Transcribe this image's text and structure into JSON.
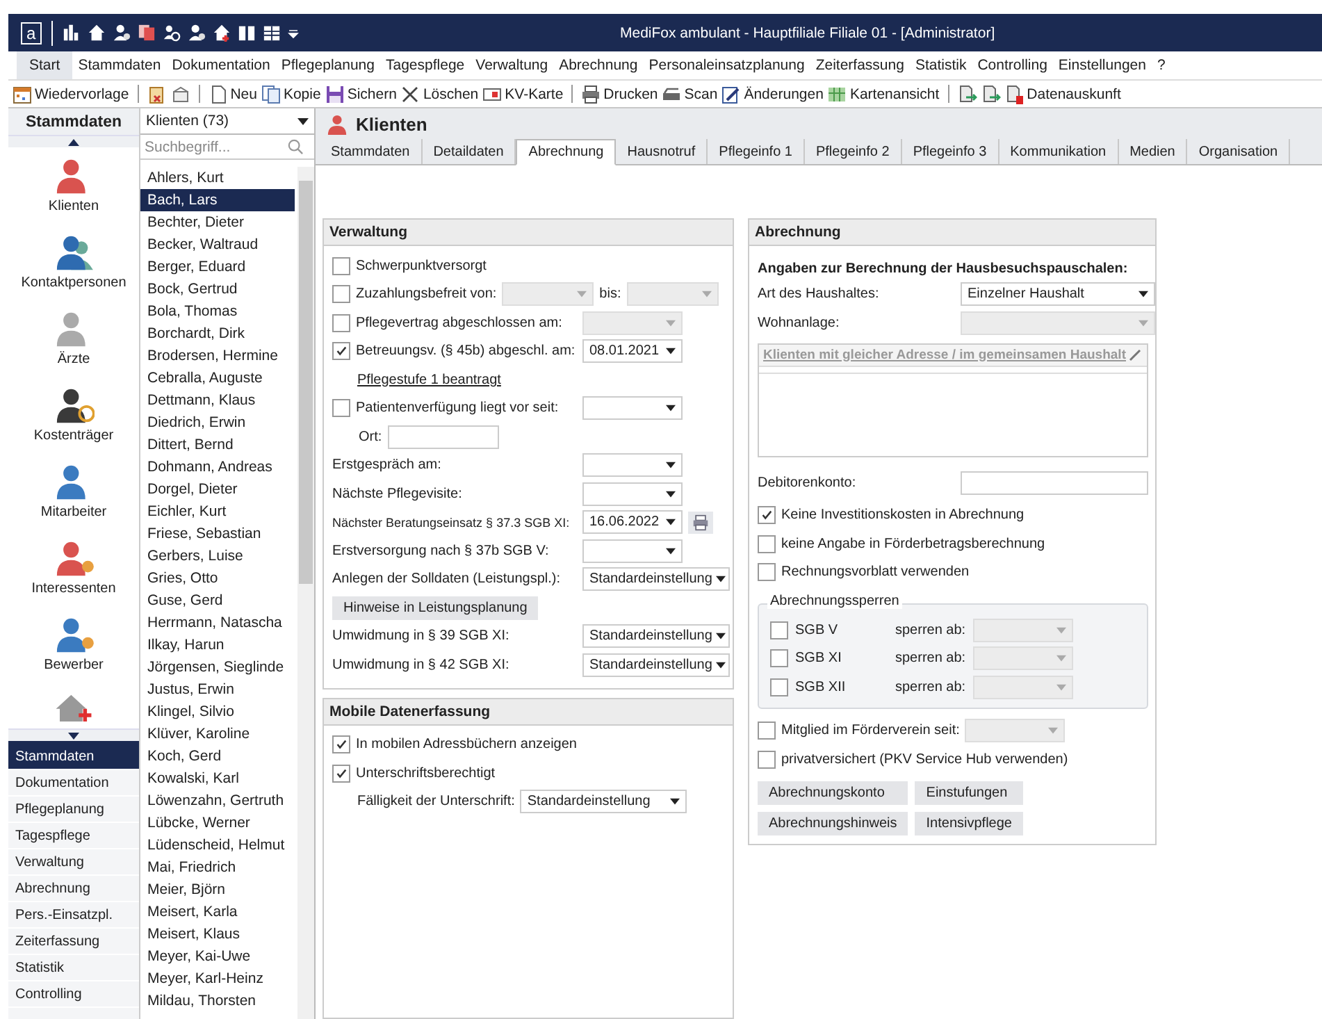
{
  "window": {
    "logo": "a",
    "title": "MediFox ambulant  -  Hauptfiliale Filiale 01 - [Administrator]"
  },
  "menu": {
    "items": [
      {
        "label": "Start",
        "selected": true
      },
      {
        "label": "Stammdaten",
        "selected": false
      },
      {
        "label": "Dokumentation",
        "selected": false
      },
      {
        "label": "Pflegeplanung",
        "selected": false
      },
      {
        "label": "Tagespflege",
        "selected": false
      },
      {
        "label": "Verwaltung",
        "selected": false
      },
      {
        "label": "Abrechnung",
        "selected": false
      },
      {
        "label": "Personaleinsatzplanung",
        "selected": false
      },
      {
        "label": "Zeiterfassung",
        "selected": false
      },
      {
        "label": "Statistik",
        "selected": false
      },
      {
        "label": "Controlling",
        "selected": false
      },
      {
        "label": "Einstellungen",
        "selected": false
      },
      {
        "label": "?",
        "selected": false
      }
    ]
  },
  "toolbar": {
    "groups": [
      [
        {
          "kind": "labeled",
          "label": "Wiedervorlage"
        }
      ],
      [
        {
          "kind": "icon"
        },
        {
          "kind": "icon"
        }
      ],
      [
        {
          "kind": "labeled",
          "label": "Neu"
        },
        {
          "kind": "labeled",
          "label": "Kopie"
        },
        {
          "kind": "labeled",
          "label": "Sichern"
        },
        {
          "kind": "labeled",
          "label": "Löschen"
        },
        {
          "kind": "labeled",
          "label": "KV-Karte"
        }
      ],
      [
        {
          "kind": "labeled",
          "label": "Drucken"
        },
        {
          "kind": "labeled",
          "label": "Scan"
        },
        {
          "kind": "labeled",
          "label": "Änderungen"
        },
        {
          "kind": "labeled",
          "label": "Kartenansicht"
        }
      ],
      [
        {
          "kind": "icon"
        },
        {
          "kind": "icon"
        },
        {
          "kind": "labeled",
          "label": "Datenauskunft"
        }
      ]
    ]
  },
  "sidebar": {
    "title": "Stammdaten",
    "items": [
      {
        "label": "Klienten"
      },
      {
        "label": "Kontaktpersonen"
      },
      {
        "label": "Ärzte"
      },
      {
        "label": "Kostenträger"
      },
      {
        "label": "Mitarbeiter"
      },
      {
        "label": "Interessenten"
      },
      {
        "label": "Bewerber"
      }
    ],
    "modules": [
      {
        "label": "Stammdaten",
        "selected": true
      },
      {
        "label": "Dokumentation",
        "selected": false
      },
      {
        "label": "Pflegeplanung",
        "selected": false
      },
      {
        "label": "Tagespflege",
        "selected": false
      },
      {
        "label": "Verwaltung",
        "selected": false
      },
      {
        "label": "Abrechnung",
        "selected": false
      },
      {
        "label": "Pers.-Einsatzpl.",
        "selected": false
      },
      {
        "label": "Zeiterfassung",
        "selected": false
      },
      {
        "label": "Statistik",
        "selected": false
      },
      {
        "label": "Controlling",
        "selected": false
      }
    ]
  },
  "client_list": {
    "filter": "Klienten (73)",
    "search": {
      "placeholder": "Suchbegriff..."
    },
    "items": [
      {
        "name": "Ahlers, Kurt",
        "selected": false
      },
      {
        "name": "Bach, Lars",
        "selected": true
      },
      {
        "name": "Bechter, Dieter",
        "selected": false
      },
      {
        "name": "Becker, Waltraud",
        "selected": false
      },
      {
        "name": "Berger, Eduard",
        "selected": false
      },
      {
        "name": "Bock, Gertrud",
        "selected": false
      },
      {
        "name": "Bola, Thomas",
        "selected": false
      },
      {
        "name": "Borchardt, Dirk",
        "selected": false
      },
      {
        "name": "Brodersen, Hermine",
        "selected": false
      },
      {
        "name": "Cebralla, Auguste",
        "selected": false
      },
      {
        "name": "Dettmann, Klaus",
        "selected": false
      },
      {
        "name": "Diedrich, Erwin",
        "selected": false
      },
      {
        "name": "Dittert, Bernd",
        "selected": false
      },
      {
        "name": "Dohmann, Andreas",
        "selected": false
      },
      {
        "name": "Dorgel, Dieter",
        "selected": false
      },
      {
        "name": "Eichler, Kurt",
        "selected": false
      },
      {
        "name": "Friese, Sebastian",
        "selected": false
      },
      {
        "name": "Gerbers, Luise",
        "selected": false
      },
      {
        "name": "Gries, Otto",
        "selected": false
      },
      {
        "name": "Guse, Gerd",
        "selected": false
      },
      {
        "name": "Herrmann, Natascha",
        "selected": false
      },
      {
        "name": "Ilkay, Harun",
        "selected": false
      },
      {
        "name": "Jörgensen, Sieglinde",
        "selected": false
      },
      {
        "name": "Justus, Erwin",
        "selected": false
      },
      {
        "name": "Klingel, Silvio",
        "selected": false
      },
      {
        "name": "Klüver, Karoline",
        "selected": false
      },
      {
        "name": "Koch, Gerd",
        "selected": false
      },
      {
        "name": "Kowalski, Karl",
        "selected": false
      },
      {
        "name": "Löwenzahn, Gertruth",
        "selected": false
      },
      {
        "name": "Lübcke, Werner",
        "selected": false
      },
      {
        "name": "Lüdenscheid, Helmut",
        "selected": false
      },
      {
        "name": "Mai, Friedrich",
        "selected": false
      },
      {
        "name": "Meier, Björn",
        "selected": false
      },
      {
        "name": "Meisert, Karla",
        "selected": false
      },
      {
        "name": "Meisert, Klaus",
        "selected": false
      },
      {
        "name": "Meyer, Kai-Uwe",
        "selected": false
      },
      {
        "name": "Meyer, Karl-Heinz",
        "selected": false
      },
      {
        "name": "Mildau, Thorsten",
        "selected": false
      }
    ]
  },
  "page": {
    "title": "Klienten",
    "tabs": [
      {
        "label": "Stammdaten",
        "selected": false
      },
      {
        "label": "Detaildaten",
        "selected": false
      },
      {
        "label": "Abrechnung",
        "selected": true
      },
      {
        "label": "Hausnotruf",
        "selected": false
      },
      {
        "label": "Pflegeinfo 1",
        "selected": false
      },
      {
        "label": "Pflegeinfo 2",
        "selected": false
      },
      {
        "label": "Pflegeinfo 3",
        "selected": false
      },
      {
        "label": "Kommunikation",
        "selected": false
      },
      {
        "label": "Medien",
        "selected": false
      },
      {
        "label": "Organisation",
        "selected": false
      }
    ]
  },
  "verwaltung": {
    "title": "Verwaltung",
    "rows": [
      {
        "kind": "check",
        "label": "Schwerpunktversorgt",
        "checked": false
      },
      {
        "kind": "check_range",
        "label": "Zuzahlungsbefreit von:",
        "checked": false,
        "to_label": "bis:",
        "from": {
          "disabled": true
        },
        "to": {
          "disabled": true
        }
      },
      {
        "kind": "check_date",
        "label": "Pflegevertrag abgeschlossen am:",
        "checked": false,
        "dropdown": {
          "disabled": true
        }
      },
      {
        "kind": "check_date",
        "label": "Betreuungsv. (§ 45b) abgeschl. am:",
        "checked": true,
        "dropdown": {
          "disabled": false,
          "value": "08.01.2021"
        }
      },
      {
        "kind": "link",
        "label": "Pflegestufe 1 beantragt"
      },
      {
        "kind": "check_date",
        "label": "Patientenverfügung liegt vor seit:",
        "checked": false,
        "dropdown": {
          "disabled": false
        }
      },
      {
        "kind": "text",
        "label": "Ort:"
      },
      {
        "kind": "date",
        "label": "Erstgespräch am:",
        "dropdown": {
          "disabled": false
        }
      },
      {
        "kind": "date",
        "label": "Nächste Pflegevisite:",
        "dropdown": {
          "disabled": false
        }
      },
      {
        "kind": "date_print",
        "label": "Nächster Beratungseinsatz § 37.3 SGB XI:",
        "dropdown": {
          "disabled": false,
          "value": "16.06.2022"
        }
      },
      {
        "kind": "date",
        "label": "Erstversorgung nach § 37b SGB V:",
        "dropdown": {
          "disabled": false
        }
      },
      {
        "kind": "select",
        "label": "Anlegen der Solldaten (Leistungspl.):",
        "dropdown": {
          "disabled": false,
          "value": "Standardeinstellung"
        }
      },
      {
        "kind": "button",
        "label": "Hinweise in Leistungsplanung"
      },
      {
        "kind": "select",
        "label": "Umwidmung in § 39 SGB XI:",
        "dropdown": {
          "disabled": false,
          "value": "Standardeinstellung"
        }
      },
      {
        "kind": "select",
        "label": "Umwidmung in § 42 SGB XI:",
        "dropdown": {
          "disabled": false,
          "value": "Standardeinstellung"
        }
      }
    ]
  },
  "mobile": {
    "title": "Mobile Datenerfassung",
    "rows": [
      {
        "kind": "check",
        "label": "In mobilen Adressbüchern anzeigen",
        "checked": true
      },
      {
        "kind": "check",
        "label": "Unterschriftsberechtigt",
        "checked": true
      },
      {
        "kind": "inline_select",
        "label": "Fälligkeit der Unterschrift:",
        "dropdown": {
          "disabled": false,
          "value": "Standardeinstellung"
        }
      }
    ]
  },
  "abrechnung": {
    "title": "Abrechnung",
    "heading": "Angaben zur Berechnung der Hausbesuchspauschalen:",
    "rows": [
      {
        "kind": "select",
        "label": "Art des Haushaltes:",
        "dropdown": {
          "disabled": false,
          "value": "Einzelner Haushalt"
        }
      },
      {
        "kind": "select",
        "label": "Wohnanlage:",
        "dropdown": {
          "disabled": true
        }
      },
      {
        "kind": "grid",
        "label": "Klienten mit gleicher Adresse / im gemeinsamen Haushalt"
      },
      {
        "kind": "text",
        "label": "Debitorenkonto:"
      },
      {
        "kind": "check",
        "label": "Keine Investitionskosten in Abrechnung",
        "checked": true
      },
      {
        "kind": "check",
        "label": "keine Angabe in Förderbetragsberechnung",
        "checked": false
      },
      {
        "kind": "check",
        "label": "Rechnungsvorblatt verwenden",
        "checked": false
      }
    ],
    "locks": {
      "title": "Abrechnungssperren",
      "rows": [
        {
          "label": "SGB V",
          "checked": false,
          "lock_label": "sperren ab:",
          "dropdown": {
            "disabled": true
          }
        },
        {
          "label": "SGB XI",
          "checked": false,
          "lock_label": "sperren ab:",
          "dropdown": {
            "disabled": true
          }
        },
        {
          "label": "SGB XII",
          "checked": false,
          "lock_label": "sperren ab:",
          "dropdown": {
            "disabled": true
          }
        }
      ]
    },
    "rows_after": [
      {
        "kind": "check_date",
        "label": "Mitglied im Förderverein seit:",
        "checked": false,
        "dropdown": {
          "disabled": true
        }
      },
      {
        "kind": "check",
        "label": "privatversichert (PKV Service Hub verwenden)",
        "checked": false
      }
    ],
    "buttons": [
      "Abrechnungskonto",
      "Einstufungen",
      "Abrechnungshinweis",
      "Intensivpflege"
    ]
  }
}
